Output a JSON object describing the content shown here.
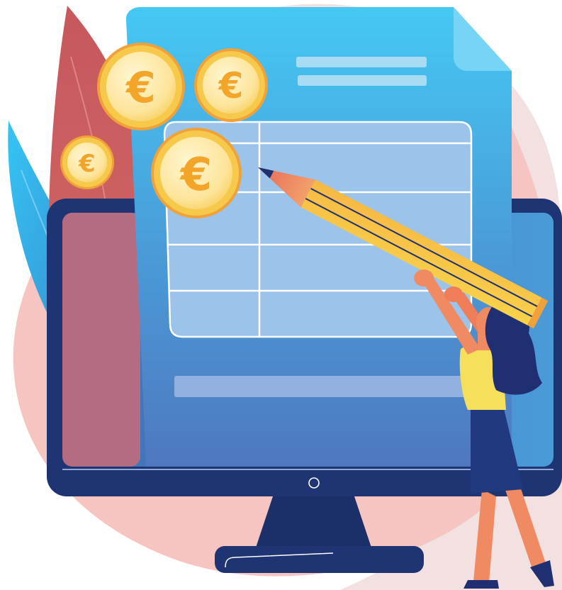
{
  "illustration": {
    "currency_symbol": "€",
    "coin_count": 4,
    "colors": {
      "background_blob": "#f6c6c2",
      "background_blob_light": "#f3dede",
      "monitor_frame": "#1f3577",
      "monitor_screen": "#4b86c4",
      "document_top": "#45c6f2",
      "document_bottom": "#4f7fc4",
      "table_fill": "#9cc3e8",
      "leaf_red": "#c95b5d",
      "leaf_blue": "#3fb6ee",
      "coin_gold": "#f2c23c",
      "coin_face": "#fde7a6",
      "coin_symbol": "#f3a52a",
      "pencil_body": "#f5c33d",
      "pencil_tip": "#ef8a63",
      "woman_shirt": "#f6e05d",
      "woman_skirt": "#203a80",
      "woman_hair": "#1f2f72",
      "woman_skin": "#f08a62"
    },
    "icons": [
      "euro-coin-icon",
      "pencil-icon",
      "monitor-power-button-icon"
    ]
  }
}
